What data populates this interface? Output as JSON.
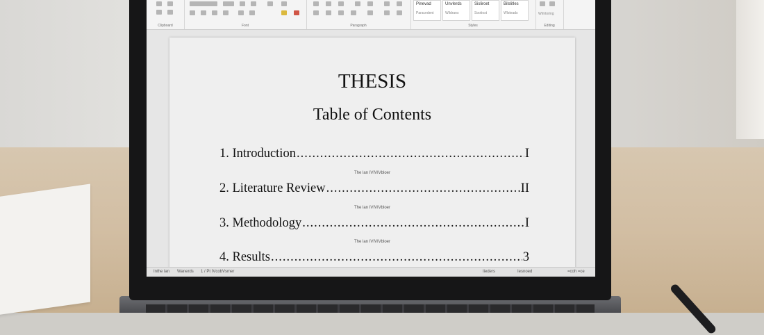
{
  "ribbon": {
    "groups": [
      "Clipboard",
      "Font",
      "Paragraph",
      "Styles",
      "Editing"
    ],
    "styles": [
      {
        "name": "Pinevad",
        "sub": "Paracedent"
      },
      {
        "name": "Unvlerds",
        "sub": "Wildrans"
      },
      {
        "name": "Sisliroet",
        "sub": "Sootiost"
      },
      {
        "name": "Bilslitles",
        "sub": "Wlsteads"
      }
    ],
    "editing_label": "Wlmtoring"
  },
  "document": {
    "title": "THESIS",
    "subtitle": "Table of Contents",
    "entries": [
      {
        "text": "1. Introduction",
        "page": "I",
        "note": "The lan IVIVIVbloer"
      },
      {
        "text": "2. Literature Review ",
        "page": "II",
        "note": "The lan IVIVIVbloer"
      },
      {
        "text": "3. Methodology ",
        "page": "I",
        "note": "The lan IVIVIVbloer"
      },
      {
        "text": "4. Results",
        "page": "3",
        "note": ""
      }
    ]
  },
  "statusbar": {
    "page_info": "Inthe lan",
    "word_info": "Wanerds",
    "lang_info": "1 / Pt IVcobVsmer",
    "view_info": "Iieders",
    "focus_info": "Iesnoed",
    "zoom_info": "=coh =ce"
  },
  "colors": {
    "page": "#efefef",
    "ribbon": "#f4f4f4",
    "bezel": "#161617"
  }
}
